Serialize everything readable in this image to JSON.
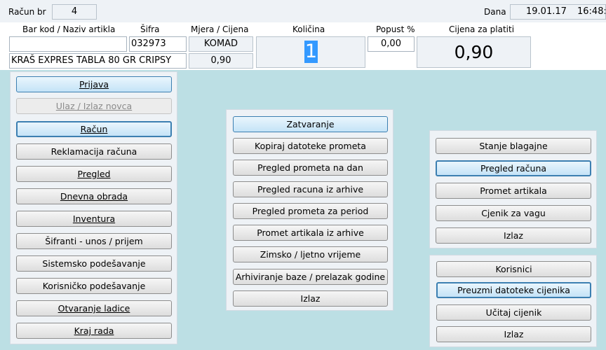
{
  "top": {
    "racun_label": "Račun br",
    "racun_no": "4",
    "dana_label": "Dana",
    "date": "19.01.17",
    "time": "16:48:"
  },
  "entry": {
    "barcode_label": "Bar kod / Naziv artikla",
    "sifra_label": "Šifra",
    "mjera_label": "Mjera / Cijena",
    "kolicina_label": "Količina",
    "popust_label": "Popust %",
    "cijena_label": "Cijena za platiti",
    "barcode_value": "",
    "sifra_value": "032973",
    "mjera_value": "KOMAD",
    "kolicina_value": "1",
    "popust_value": "0,00",
    "cijena_value": "0,90",
    "naziv_value": "KRAŠ EXPRES TABLA 80 GR CRIPSY",
    "price_value": "0,90"
  },
  "left_menu": [
    {
      "label": "Prijava"
    },
    {
      "label": "Ulaz / Izlaz novca"
    },
    {
      "label": "Račun"
    },
    {
      "label": "Reklamacija računa"
    },
    {
      "label": "Pregled"
    },
    {
      "label": "Dnevna obrada"
    },
    {
      "label": "Inventura"
    },
    {
      "label": "Šifranti - unos / prijem"
    },
    {
      "label": "Sistemsko podešavanje"
    },
    {
      "label": "Korisničko podešavanje"
    },
    {
      "label": "Otvaranje ladice"
    },
    {
      "label": "Kraj rada"
    }
  ],
  "middle_menu": [
    {
      "label": "Zatvaranje"
    },
    {
      "label": "Kopiraj datoteke prometa"
    },
    {
      "label": "Pregled prometa na dan"
    },
    {
      "label": "Pregled racuna iz arhive"
    },
    {
      "label": "Pregled prometa za period"
    },
    {
      "label": "Promet artikala iz arhive"
    },
    {
      "label": "Zimsko / ljetno vrijeme"
    },
    {
      "label": "Arhiviranje baze / prelazak godine"
    },
    {
      "label": "Izlaz"
    }
  ],
  "right_menu_1": [
    {
      "label": "Stanje blagajne"
    },
    {
      "label": "Pregled računa"
    },
    {
      "label": "Promet artikala"
    },
    {
      "label": "Cjenik za vagu"
    },
    {
      "label": "Izlaz"
    }
  ],
  "right_menu_2": [
    {
      "label": "Korisnici"
    },
    {
      "label": "Preuzmi datoteke cijenika"
    },
    {
      "label": "Učitaj cijenik"
    },
    {
      "label": "Izlaz"
    }
  ],
  "colors": {
    "background": "#bcdfe4",
    "panel": "#eef2f6",
    "selection": "#3399ff",
    "focus_border": "#3c7fb1"
  }
}
